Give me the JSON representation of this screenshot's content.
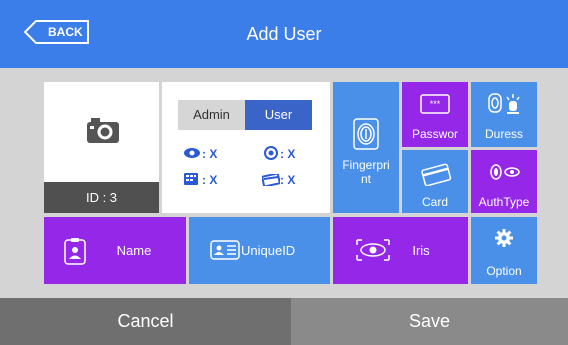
{
  "header": {
    "back_label": "BACK",
    "title": "Add User"
  },
  "photo": {
    "id_label": "ID : 3"
  },
  "role": {
    "options": [
      "Admin",
      "User"
    ],
    "selected": "User",
    "permissions": [
      {
        "icon": "eye-icon",
        "value": ": X"
      },
      {
        "icon": "fingerprint-small-icon",
        "value": ": X"
      },
      {
        "icon": "keypad-icon",
        "value": ": X"
      },
      {
        "icon": "card-small-icon",
        "value": ": X"
      }
    ]
  },
  "tiles": {
    "fingerprint": "Fingerpri\nnt",
    "password": "Passwor",
    "duress": "Duress",
    "card": "Card",
    "authtype": "AuthType",
    "name": "Name",
    "uniqueid": "UniqueID",
    "iris": "Iris",
    "option": "Option"
  },
  "footer": {
    "cancel": "Cancel",
    "save": "Save"
  },
  "colors": {
    "header": "#3b7de9",
    "blue_tile": "#4a90e8",
    "purple_tile": "#9427e8",
    "footer_left": "#6f6f6f",
    "footer_right": "#8a8a8a"
  }
}
